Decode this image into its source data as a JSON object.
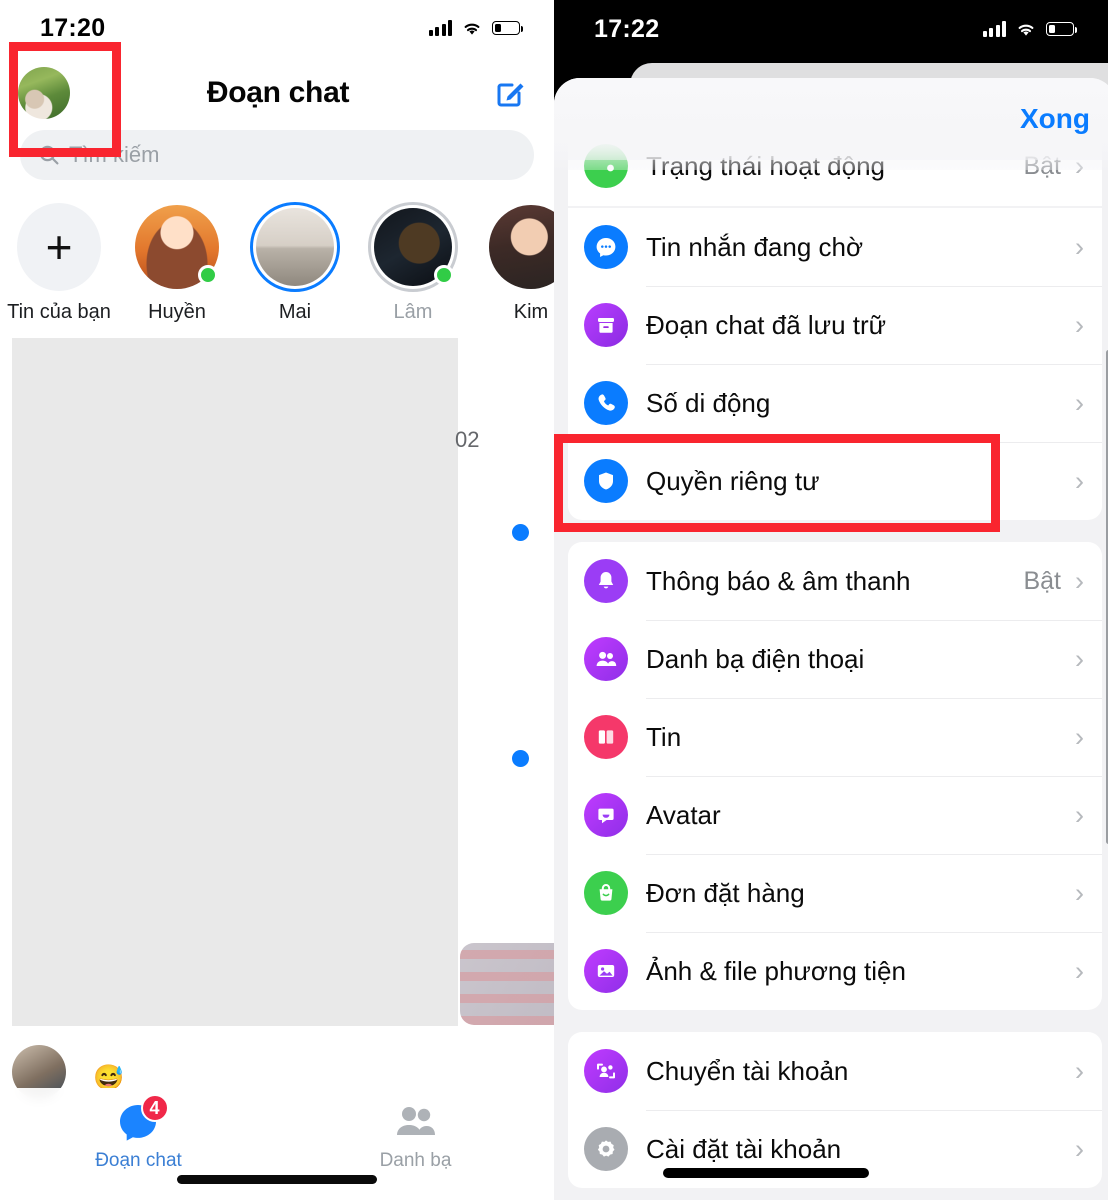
{
  "left_screen": {
    "status_bar": {
      "time": "17:20",
      "signal_icon": "cellular-bars-icon",
      "wifi_icon": "wifi-icon",
      "battery_icon": "battery-low-icon"
    },
    "header": {
      "title": "Đoạn chat",
      "avatar_name": "profile-avatar",
      "compose_icon": "compose-icon"
    },
    "search": {
      "placeholder": "Tìm kiếm",
      "icon": "search-icon"
    },
    "stories": [
      {
        "label": "Tin của bạn",
        "ring": "none",
        "online": false,
        "add": true
      },
      {
        "label": "Huyền",
        "ring": "none",
        "online": true,
        "add": false
      },
      {
        "label": "Mai",
        "ring": "blue",
        "online": false,
        "add": false
      },
      {
        "label": "Lâm",
        "ring": "gray",
        "online": true,
        "add": false
      },
      {
        "label": "Kim",
        "ring": "none",
        "online": false,
        "add": false
      }
    ],
    "chat_list": {
      "redacted": true,
      "time_fragment": "02",
      "unread_dots": 2
    },
    "tabs": [
      {
        "label": "Đoạn chat",
        "badge": "4",
        "active": true,
        "icon": "chat-bubble-icon"
      },
      {
        "label": "Danh bạ",
        "badge": "",
        "active": false,
        "icon": "contacts-icon"
      }
    ],
    "highlight": {
      "color": "#f9252f",
      "target": "profile-avatar"
    }
  },
  "right_screen": {
    "status_bar": {
      "time": "17:22",
      "signal_icon": "cellular-bars-icon",
      "wifi_icon": "wifi-icon",
      "battery_icon": "battery-low-icon"
    },
    "sheet": {
      "done_label": "Xong"
    },
    "partial_row": {
      "label": "Trạng thái hoạt động",
      "value": "Bật",
      "icon": "active-status-icon",
      "icon_color": "#3ccf4e"
    },
    "groups": [
      {
        "rows": [
          {
            "label": "Tin nhắn đang chờ",
            "value": "",
            "icon": "message-requests-icon",
            "icon_class": "ic-blue",
            "glyph": "chat-dots"
          },
          {
            "label": "Đoạn chat đã lưu trữ",
            "value": "",
            "icon": "archive-icon",
            "icon_class": "ic-purplegrad",
            "glyph": "archive"
          },
          {
            "label": "Số di động",
            "value": "",
            "icon": "phone-icon",
            "icon_class": "ic-blue",
            "glyph": "phone"
          },
          {
            "label": "Quyền riêng tư",
            "value": "",
            "icon": "shield-privacy-icon",
            "icon_class": "ic-blue",
            "glyph": "shield",
            "highlighted": true
          }
        ]
      },
      {
        "rows": [
          {
            "label": "Thông báo & âm thanh",
            "value": "Bật",
            "icon": "bell-icon",
            "icon_class": "ic-purple",
            "glyph": "bell"
          },
          {
            "label": "Danh bạ điện thoại",
            "value": "",
            "icon": "contacts-icon",
            "icon_class": "ic-violet",
            "glyph": "people"
          },
          {
            "label": "Tin",
            "value": "",
            "icon": "stories-icon",
            "icon_class": "ic-pink",
            "glyph": "book"
          },
          {
            "label": "Avatar",
            "value": "",
            "icon": "avatar-icon",
            "icon_class": "ic-violet",
            "glyph": "avatarface"
          },
          {
            "label": "Đơn đặt hàng",
            "value": "",
            "icon": "orders-icon",
            "icon_class": "ic-green",
            "glyph": "bag"
          },
          {
            "label": "Ảnh & file phương tiện",
            "value": "",
            "icon": "media-icon",
            "icon_class": "ic-violet",
            "glyph": "photo"
          }
        ]
      },
      {
        "rows": [
          {
            "label": "Chuyển tài khoản",
            "value": "",
            "icon": "switch-account-icon",
            "icon_class": "ic-violet",
            "glyph": "switch"
          },
          {
            "label": "Cài đặt tài khoản",
            "value": "",
            "icon": "gear-icon",
            "icon_class": "ic-gray",
            "glyph": "gear"
          }
        ]
      }
    ],
    "highlight": {
      "color": "#f9252f",
      "target": "Quyền riêng tư"
    },
    "chevron": "›"
  }
}
